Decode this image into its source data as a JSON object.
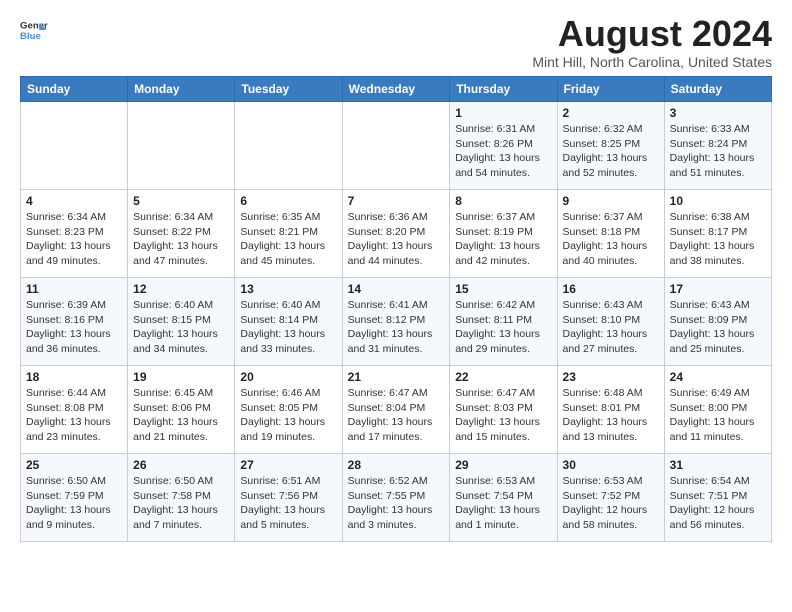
{
  "header": {
    "logo_line1": "General",
    "logo_line2": "Blue",
    "month_year": "August 2024",
    "location": "Mint Hill, North Carolina, United States"
  },
  "weekdays": [
    "Sunday",
    "Monday",
    "Tuesday",
    "Wednesday",
    "Thursday",
    "Friday",
    "Saturday"
  ],
  "weeks": [
    [
      {
        "day": "",
        "info": ""
      },
      {
        "day": "",
        "info": ""
      },
      {
        "day": "",
        "info": ""
      },
      {
        "day": "",
        "info": ""
      },
      {
        "day": "1",
        "info": "Sunrise: 6:31 AM\nSunset: 8:26 PM\nDaylight: 13 hours\nand 54 minutes."
      },
      {
        "day": "2",
        "info": "Sunrise: 6:32 AM\nSunset: 8:25 PM\nDaylight: 13 hours\nand 52 minutes."
      },
      {
        "day": "3",
        "info": "Sunrise: 6:33 AM\nSunset: 8:24 PM\nDaylight: 13 hours\nand 51 minutes."
      }
    ],
    [
      {
        "day": "4",
        "info": "Sunrise: 6:34 AM\nSunset: 8:23 PM\nDaylight: 13 hours\nand 49 minutes."
      },
      {
        "day": "5",
        "info": "Sunrise: 6:34 AM\nSunset: 8:22 PM\nDaylight: 13 hours\nand 47 minutes."
      },
      {
        "day": "6",
        "info": "Sunrise: 6:35 AM\nSunset: 8:21 PM\nDaylight: 13 hours\nand 45 minutes."
      },
      {
        "day": "7",
        "info": "Sunrise: 6:36 AM\nSunset: 8:20 PM\nDaylight: 13 hours\nand 44 minutes."
      },
      {
        "day": "8",
        "info": "Sunrise: 6:37 AM\nSunset: 8:19 PM\nDaylight: 13 hours\nand 42 minutes."
      },
      {
        "day": "9",
        "info": "Sunrise: 6:37 AM\nSunset: 8:18 PM\nDaylight: 13 hours\nand 40 minutes."
      },
      {
        "day": "10",
        "info": "Sunrise: 6:38 AM\nSunset: 8:17 PM\nDaylight: 13 hours\nand 38 minutes."
      }
    ],
    [
      {
        "day": "11",
        "info": "Sunrise: 6:39 AM\nSunset: 8:16 PM\nDaylight: 13 hours\nand 36 minutes."
      },
      {
        "day": "12",
        "info": "Sunrise: 6:40 AM\nSunset: 8:15 PM\nDaylight: 13 hours\nand 34 minutes."
      },
      {
        "day": "13",
        "info": "Sunrise: 6:40 AM\nSunset: 8:14 PM\nDaylight: 13 hours\nand 33 minutes."
      },
      {
        "day": "14",
        "info": "Sunrise: 6:41 AM\nSunset: 8:12 PM\nDaylight: 13 hours\nand 31 minutes."
      },
      {
        "day": "15",
        "info": "Sunrise: 6:42 AM\nSunset: 8:11 PM\nDaylight: 13 hours\nand 29 minutes."
      },
      {
        "day": "16",
        "info": "Sunrise: 6:43 AM\nSunset: 8:10 PM\nDaylight: 13 hours\nand 27 minutes."
      },
      {
        "day": "17",
        "info": "Sunrise: 6:43 AM\nSunset: 8:09 PM\nDaylight: 13 hours\nand 25 minutes."
      }
    ],
    [
      {
        "day": "18",
        "info": "Sunrise: 6:44 AM\nSunset: 8:08 PM\nDaylight: 13 hours\nand 23 minutes."
      },
      {
        "day": "19",
        "info": "Sunrise: 6:45 AM\nSunset: 8:06 PM\nDaylight: 13 hours\nand 21 minutes."
      },
      {
        "day": "20",
        "info": "Sunrise: 6:46 AM\nSunset: 8:05 PM\nDaylight: 13 hours\nand 19 minutes."
      },
      {
        "day": "21",
        "info": "Sunrise: 6:47 AM\nSunset: 8:04 PM\nDaylight: 13 hours\nand 17 minutes."
      },
      {
        "day": "22",
        "info": "Sunrise: 6:47 AM\nSunset: 8:03 PM\nDaylight: 13 hours\nand 15 minutes."
      },
      {
        "day": "23",
        "info": "Sunrise: 6:48 AM\nSunset: 8:01 PM\nDaylight: 13 hours\nand 13 minutes."
      },
      {
        "day": "24",
        "info": "Sunrise: 6:49 AM\nSunset: 8:00 PM\nDaylight: 13 hours\nand 11 minutes."
      }
    ],
    [
      {
        "day": "25",
        "info": "Sunrise: 6:50 AM\nSunset: 7:59 PM\nDaylight: 13 hours\nand 9 minutes."
      },
      {
        "day": "26",
        "info": "Sunrise: 6:50 AM\nSunset: 7:58 PM\nDaylight: 13 hours\nand 7 minutes."
      },
      {
        "day": "27",
        "info": "Sunrise: 6:51 AM\nSunset: 7:56 PM\nDaylight: 13 hours\nand 5 minutes."
      },
      {
        "day": "28",
        "info": "Sunrise: 6:52 AM\nSunset: 7:55 PM\nDaylight: 13 hours\nand 3 minutes."
      },
      {
        "day": "29",
        "info": "Sunrise: 6:53 AM\nSunset: 7:54 PM\nDaylight: 13 hours\nand 1 minute."
      },
      {
        "day": "30",
        "info": "Sunrise: 6:53 AM\nSunset: 7:52 PM\nDaylight: 12 hours\nand 58 minutes."
      },
      {
        "day": "31",
        "info": "Sunrise: 6:54 AM\nSunset: 7:51 PM\nDaylight: 12 hours\nand 56 minutes."
      }
    ]
  ]
}
